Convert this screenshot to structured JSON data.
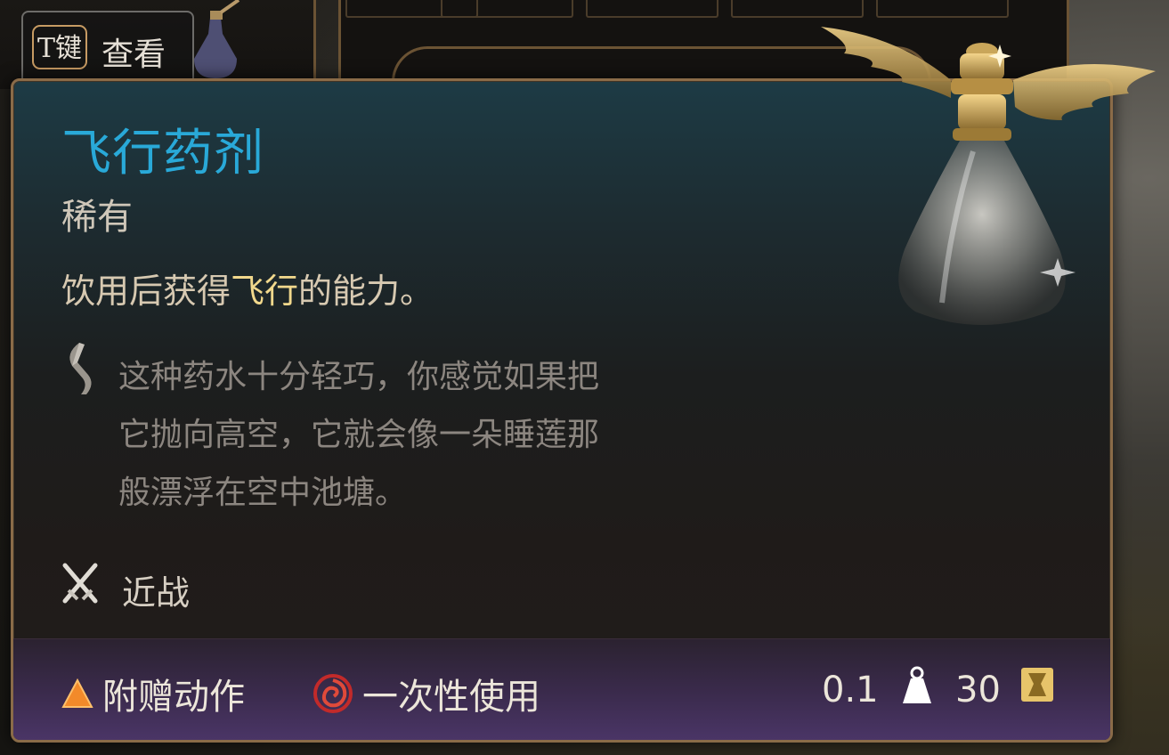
{
  "hint": {
    "key": "T键",
    "label": "查看"
  },
  "item": {
    "name": "飞行药剂",
    "rarity": "稀有",
    "effect_prefix": "饮用后获得",
    "effect_highlight": "飞行",
    "effect_suffix": "的能力。",
    "lore_lines": [
      "这种药水十分轻巧，你感觉如果把",
      "它抛向高空，它就会像一朵睡莲那",
      "般漂浮在空中池塘。"
    ],
    "weapon_type": "近战",
    "art_icon": "winged-potion-flask",
    "lore_icon": "scroll-quill-icon",
    "weapon_icon": "crossed-swords-icon"
  },
  "footer": {
    "action_type": "附赠动作",
    "action_icon": "orange-triangle-icon",
    "usage": "一次性使用",
    "usage_icon": "red-swirl-icon",
    "weight": "0.1",
    "weight_icon": "weight-icon",
    "price": "30",
    "price_icon": "gold-coin-icon"
  },
  "colors": {
    "title": "#29a9d8",
    "highlight": "#f1d88c",
    "border": "#8a6b48",
    "footer_bg": "#3b2b4d"
  }
}
